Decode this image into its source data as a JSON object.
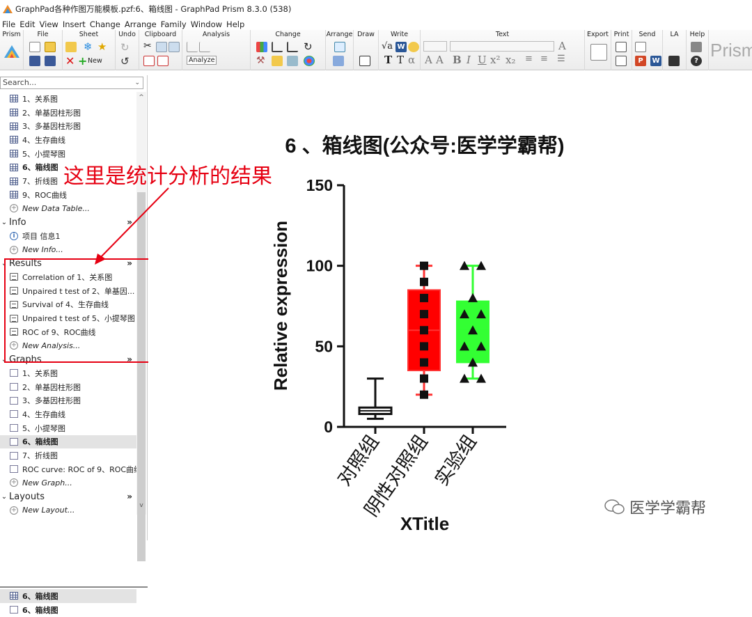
{
  "window": {
    "title": "GraphPad各种作图万能模板.pzf:6、箱线图 - GraphPad Prism 8.3.0 (538)"
  },
  "menu": [
    "File",
    "Edit",
    "View",
    "Insert",
    "Change",
    "Arrange",
    "Family",
    "Window",
    "Help"
  ],
  "ribbon": {
    "groups": [
      "Prism",
      "File",
      "Sheet",
      "Undo",
      "Clipboard",
      "Analysis",
      "Change",
      "Arrange",
      "Draw",
      "Write",
      "Text",
      "Export",
      "Print",
      "Send",
      "LA",
      "Help"
    ],
    "new_label": "New",
    "analyze_label": "Analyze",
    "brand": "Prism"
  },
  "search": {
    "placeholder": "Search..."
  },
  "data_tables": [
    {
      "label": "1、关系图",
      "bold": false
    },
    {
      "label": "2、单基因柱形图",
      "bold": false
    },
    {
      "label": "3、多基因柱形图",
      "bold": false
    },
    {
      "label": "4、生存曲线",
      "bold": false
    },
    {
      "label": "5、小提琴图",
      "bold": false
    },
    {
      "label": "6、箱线图",
      "bold": true
    },
    {
      "label": "7、折线图",
      "bold": false
    },
    {
      "label": "9、ROC曲线",
      "bold": false
    }
  ],
  "new_data_table": "New Data Table...",
  "info": {
    "header": "Info",
    "items": [
      "项目 信息1"
    ],
    "new": "New Info..."
  },
  "results": {
    "header": "Results",
    "items": [
      "Correlation of 1、关系图",
      "Unpaired t test of 2、单基因...",
      "Survival of 4、生存曲线",
      "Unpaired t test of 5、小提琴图",
      "ROC of 9、ROC曲线"
    ],
    "new": "New Analysis..."
  },
  "graphs": {
    "header": "Graphs",
    "items": [
      {
        "label": "1、关系图",
        "bold": false
      },
      {
        "label": "2、单基因柱形图",
        "bold": false
      },
      {
        "label": "3、多基因柱形图",
        "bold": false
      },
      {
        "label": "4、生存曲线",
        "bold": false
      },
      {
        "label": "5、小提琴图",
        "bold": false
      },
      {
        "label": "6、箱线图",
        "bold": true
      },
      {
        "label": "7、折线图",
        "bold": false
      },
      {
        "label": "ROC curve: ROC of 9、ROC曲线",
        "bold": false
      }
    ],
    "new": "New Graph..."
  },
  "layouts": {
    "header": "Layouts",
    "new": "New Layout..."
  },
  "bottom_tabs": [
    "6、箱线图",
    "6、箱线图"
  ],
  "annotation": "这里是统计分析的结果",
  "watermark": "医学学霸帮",
  "colors": {
    "accent_red": "#e60012",
    "box_red": "#ff0000",
    "box_green": "#33ff33",
    "whisker_red": "#ff3333",
    "whisker_green": "#33ff33"
  },
  "chart_data": {
    "type": "box",
    "title": "6 、箱线图(公众号:医学学霸帮)",
    "xlabel": "XTitle",
    "ylabel": "Relative expression",
    "ylim": [
      0,
      150
    ],
    "yticks": [
      0,
      50,
      100,
      150
    ],
    "categories": [
      "对照组",
      "阴性对照组",
      "实验组"
    ],
    "series": [
      {
        "category": "对照组",
        "min": 5,
        "q1": 8,
        "median": 10,
        "q3": 12,
        "max": 30,
        "points": [],
        "marker": "none"
      },
      {
        "category": "阴性对照组",
        "min": 20,
        "q1": 35,
        "median": 60,
        "q3": 85,
        "max": 100,
        "points": [
          100,
          90,
          80,
          70,
          60,
          50,
          40,
          30,
          20
        ],
        "marker": "square"
      },
      {
        "category": "实验组",
        "min": 30,
        "q1": 40,
        "median": 60,
        "q3": 78,
        "max": 100,
        "points": [
          100,
          100,
          80,
          70,
          70,
          60,
          50,
          50,
          40,
          30,
          30
        ],
        "marker": "triangle"
      }
    ]
  }
}
